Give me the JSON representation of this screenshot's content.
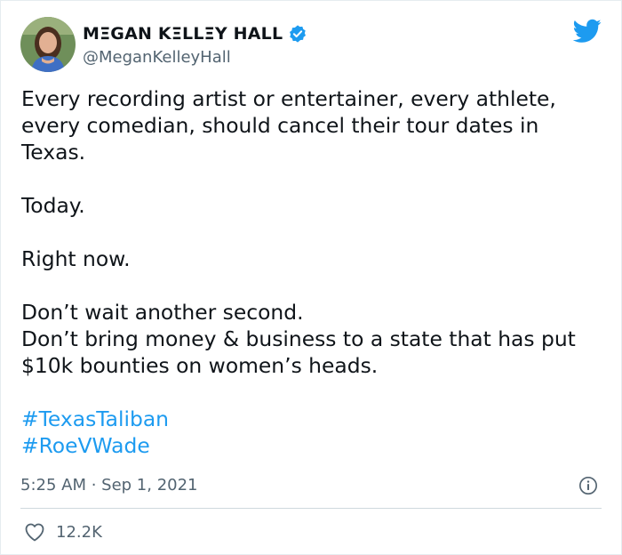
{
  "author": {
    "display_name": "MΞGAN KΞLLΞY HALL",
    "handle": "@MeganKelleyHall",
    "verified": true
  },
  "tweet": {
    "lines": [
      "Every recording artist or entertainer, every athlete, every comedian, should cancel their tour dates in Texas.",
      "Today.",
      "Right now.",
      "Don’t wait another second.\nDon’t bring money & business to a state that has put $10k bounties on women’s heads."
    ],
    "hashtags": [
      "#TexasTaliban",
      "#RoeVWade"
    ],
    "timestamp": "5:25 AM · Sep 1, 2021"
  },
  "engagement": {
    "likes": "12.2K"
  },
  "colors": {
    "accent": "#1d9bf0",
    "secondary_text": "#536471",
    "divider": "#cfd9de"
  },
  "icons": {
    "brand": "twitter-bird-icon",
    "verified": "verified-badge-icon",
    "info": "info-icon",
    "like": "heart-icon"
  }
}
